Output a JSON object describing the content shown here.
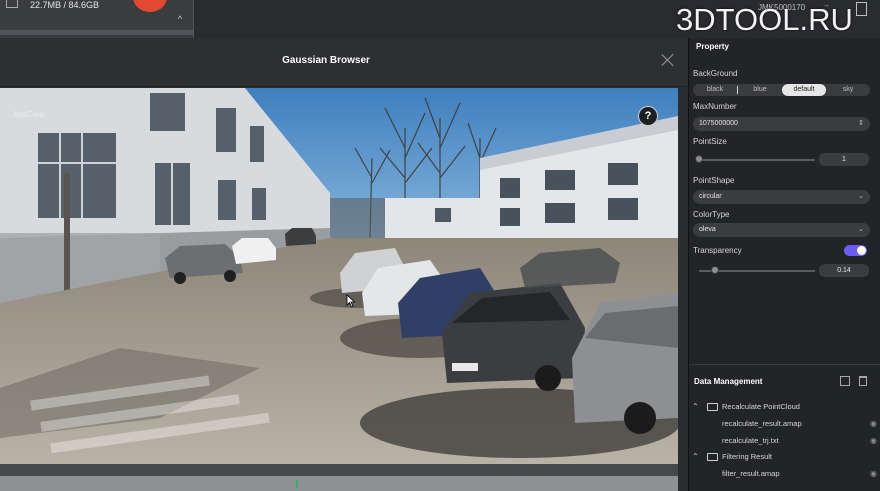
{
  "topbar": {
    "storage_text": "22.7MB / 84.6GB",
    "collapse_glyph": "^",
    "device_id": "JMK5000170",
    "arrows_glyph": "→"
  },
  "watermark": "3DTOOL.RU",
  "dialog": {
    "title": "Gaussian Browser",
    "close_icon": "close-icon",
    "help_label": "?",
    "viewport_caption": "JmsCrea"
  },
  "panel": {
    "title": "Property",
    "background": {
      "label": "BackGround",
      "options": [
        "black",
        "blue",
        "default",
        "sky"
      ],
      "selected": "default"
    },
    "max_number": {
      "label": "MaxNumber",
      "value": "1075000000"
    },
    "point_size": {
      "label": "PointSize",
      "value": "1",
      "level": 0
    },
    "point_shape": {
      "label": "PointShape",
      "value": "circular"
    },
    "color_type": {
      "label": "ColorType",
      "value": "oleva"
    },
    "transparency": {
      "label": "Transparency",
      "enabled": true,
      "value": "0.14",
      "level": 0.14
    },
    "data_management": {
      "title": "Data Management",
      "groups": [
        {
          "name": "Recalculate PointCloud",
          "files": [
            "recalculate_result.amap",
            "recalculate_trj.txt"
          ]
        },
        {
          "name": "Filtering Result",
          "files": [
            "filter_result.amap"
          ]
        }
      ]
    }
  },
  "colors": {
    "accent_toggle": "#6b5cf5",
    "record_button": "#e24a2f",
    "panel_bg": "#232427"
  }
}
